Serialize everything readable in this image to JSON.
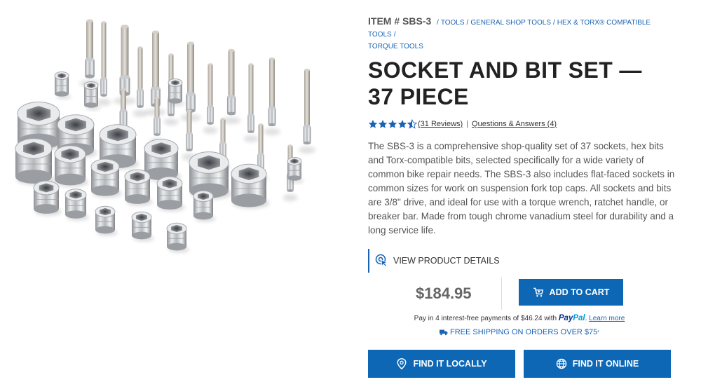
{
  "breadcrumb": {
    "item_code": "ITEM # SBS-3",
    "links": [
      "TOOLS",
      "GENERAL SHOP TOOLS",
      "HEX & TORX® COMPATIBLE TOOLS",
      "TORQUE TOOLS"
    ]
  },
  "product": {
    "title_line1": "SOCKET AND BIT SET —",
    "title_line2": "37 PIECE",
    "rating": 4.5,
    "reviews_link": "(31 Reviews)",
    "qa_link": "Questions & Answers (4)",
    "description": "The SBS-3 is a comprehensive shop-quality set of 37 sockets, hex bits and Torx-compatible bits, selected specifically for a wide variety of common bike repair needs. The SBS-3 also includes flat-faced sockets in common sizes for work on suspension fork top caps. All sockets and bits are 3/8\" drive, and ideal for use with a torque wrench, ratchet handle, or breaker bar. Made from tough chrome vanadium steel for durability and a long service life.",
    "details_label": "VIEW PRODUCT DETAILS",
    "price": "$184.95",
    "add_to_cart_label": "ADD TO CART"
  },
  "paypal": {
    "prefix": "Pay in 4 interest-free payments of $46.24 with",
    "logo_pay": "Pay",
    "logo_pal": "Pal",
    "learn_more": "Learn more"
  },
  "shipping": {
    "text": "FREE SHIPPING ON ORDERS OVER $75",
    "mark": "*"
  },
  "buttons": {
    "find_locally": "FIND IT LOCALLY",
    "find_online": "FIND IT ONLINE"
  },
  "colors": {
    "accent": "#0d67b5",
    "link": "#1a63b3",
    "star": "#1a63b3"
  },
  "icons": [
    "cart-icon",
    "pointer-click-icon",
    "location-pin-icon",
    "globe-icon",
    "truck-icon",
    "star-icon"
  ]
}
